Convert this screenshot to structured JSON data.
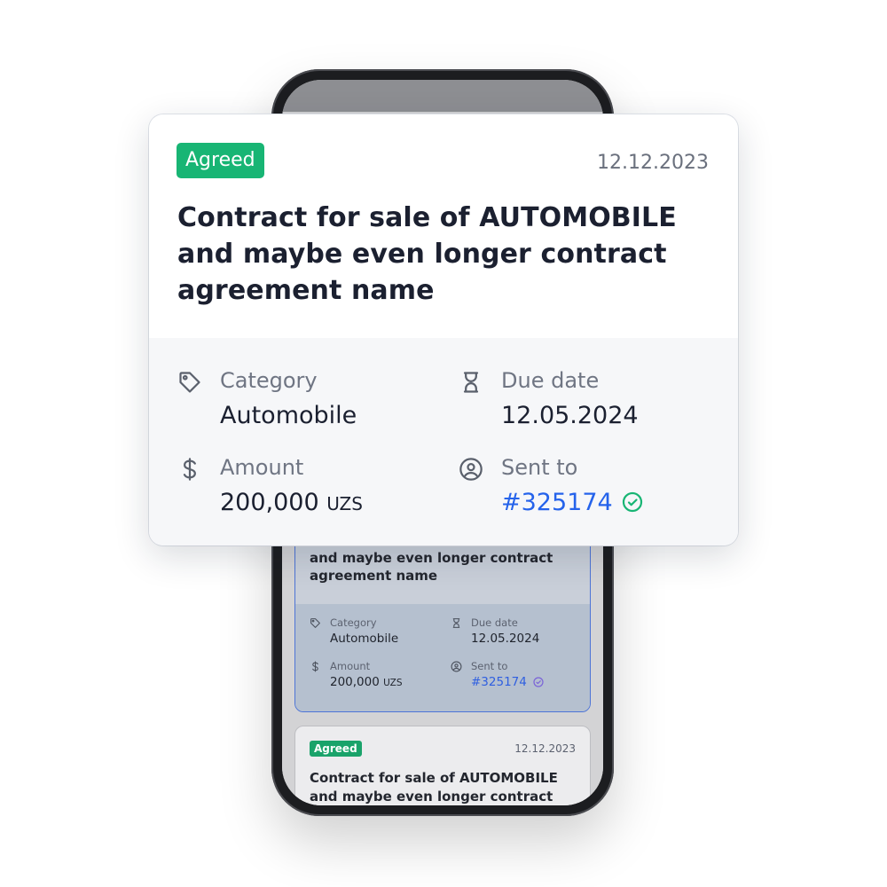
{
  "card": {
    "status": "Agreed",
    "date": "12.12.2023",
    "title": "Contract for sale of AUTOMOBILE and maybe even longer contract agreement name",
    "category_label": "Category",
    "category_value": "Automobile",
    "due_label": "Due date",
    "due_value": "12.05.2024",
    "amount_label": "Amount",
    "amount_value": "200,000",
    "amount_unit": "UZS",
    "sent_label": "Sent to",
    "sent_value": "#325174"
  },
  "phone_cards": [
    {
      "title": "Contract for sale of AUTOMOBILE and maybe even longer contract agreement name",
      "category_label": "Category",
      "category_value": "Automobile",
      "due_label": "Due date",
      "due_value": "12.05.2024",
      "amount_label": "Amount",
      "amount_value": "200,000",
      "amount_unit": "UZS",
      "sent_label": "Sent to",
      "sent_value": "#325174"
    },
    {
      "status": "Agreed",
      "date": "12.12.2023",
      "title": "Contract for sale of AUTOMOBILE and maybe even longer contract"
    }
  ],
  "colors": {
    "status_green": "#18b574",
    "link_blue": "#2563eb",
    "selected_border": "#4d74d6"
  },
  "icons": [
    "tag-icon",
    "hourglass-icon",
    "dollar-icon",
    "user-circle-icon",
    "check-circle-icon"
  ]
}
